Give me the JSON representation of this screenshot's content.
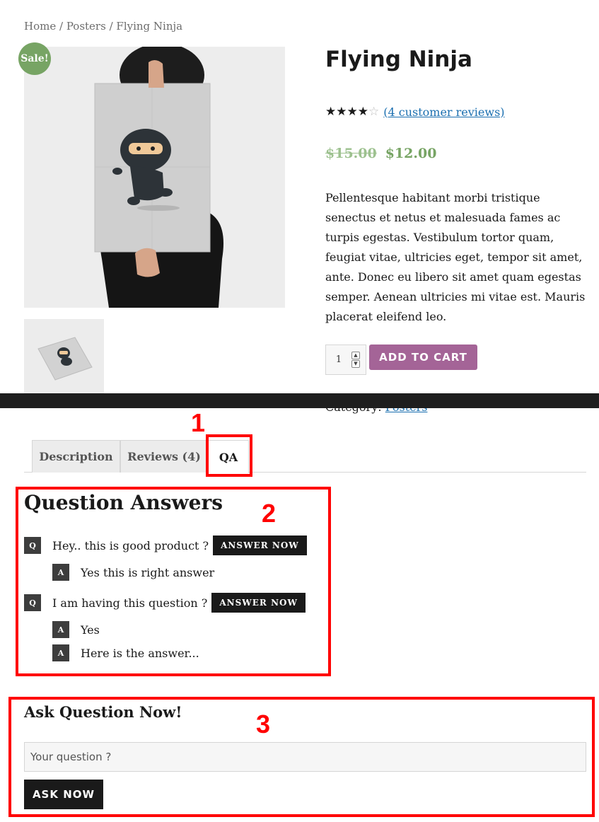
{
  "breadcrumb": {
    "items": [
      "Home",
      "Posters",
      "Flying Ninja"
    ],
    "separator": " / "
  },
  "product": {
    "sale_badge": "Sale!",
    "title": "Flying Ninja",
    "rating": 4,
    "rating_max": 5,
    "reviews_link": "(4 customer reviews)",
    "price_old": "$15.00",
    "price_new": "$12.00",
    "description": "Pellentesque habitant morbi tristique senectus et netus et malesuada fames ac turpis egestas. Vestibulum tortor quam, feugiat vitae, ultricies eget, tempor sit amet, ante. Donec eu libero sit amet quam egestas semper. Aenean ultricies mi vitae est. Mauris placerat eleifend leo.",
    "quantity": "1",
    "add_to_cart_label": "ADD TO CART",
    "category_label": "Category:",
    "category_value": "Posters",
    "main_image_icon": "poster-ninja-image",
    "thumbnail_icon": "poster-thumbnail-image"
  },
  "tabs": [
    {
      "label": "Description",
      "active": false
    },
    {
      "label": "Reviews (4)",
      "active": false
    },
    {
      "label": "QA",
      "active": true
    }
  ],
  "qa": {
    "title": "Question Answers",
    "question_badge": "Q",
    "answer_badge": "A",
    "answer_now_label": "ANSWER NOW",
    "questions": [
      {
        "text": "Hey.. this is good product ?",
        "answers": [
          "Yes this is right answer"
        ]
      },
      {
        "text": "I am having this question ?",
        "answers": [
          "Yes",
          "Here is the answer..."
        ]
      }
    ]
  },
  "ask": {
    "title": "Ask Question Now!",
    "placeholder": "Your question ?",
    "button_label": "ASK NOW"
  },
  "annotations": [
    "1",
    "2",
    "3"
  ],
  "colors": {
    "annotation": "#ff0000",
    "sale_badge": "#77a464",
    "price": "#77a464",
    "add_to_cart": "#a46497",
    "link": "#1a6fb0",
    "dark_button": "#1a1a1a"
  }
}
